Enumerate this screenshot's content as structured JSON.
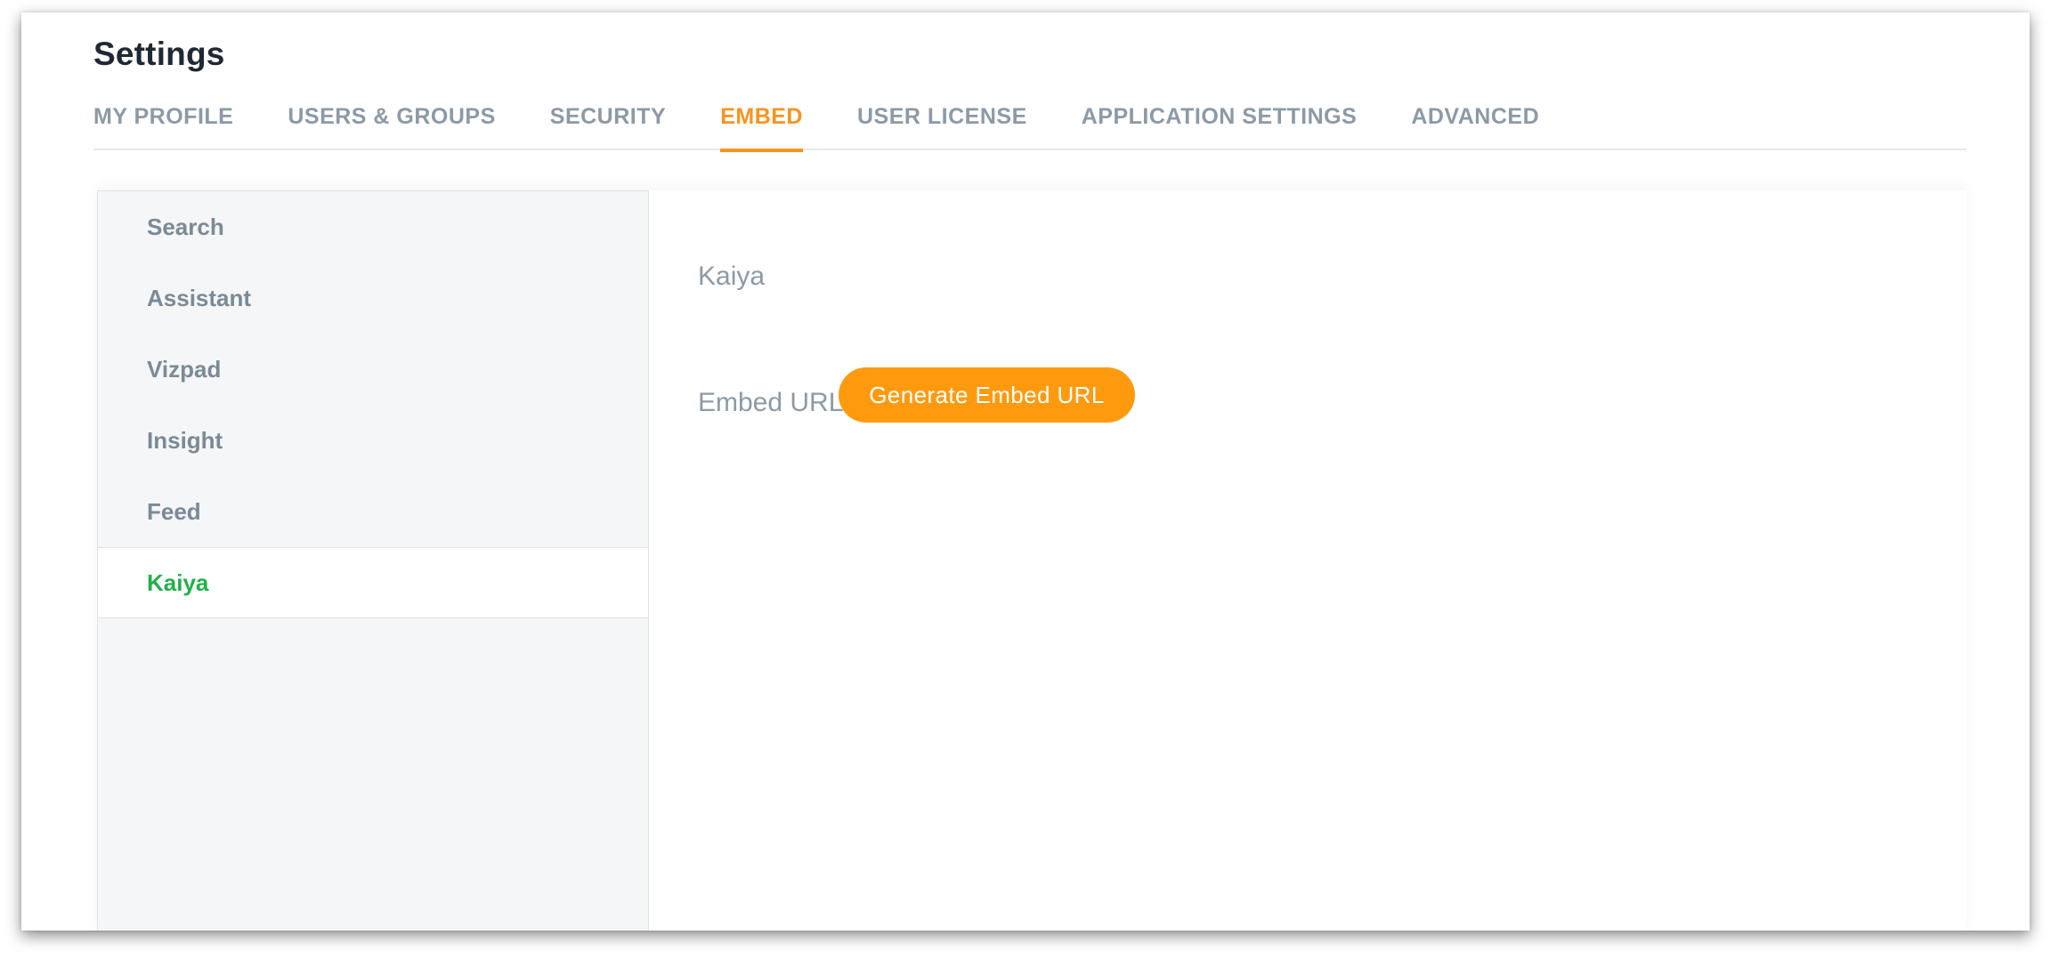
{
  "header": {
    "title": "Settings"
  },
  "tabs": [
    {
      "label": "MY PROFILE",
      "active": false
    },
    {
      "label": "USERS & GROUPS",
      "active": false
    },
    {
      "label": "SECURITY",
      "active": false
    },
    {
      "label": "EMBED",
      "active": true
    },
    {
      "label": "USER LICENSE",
      "active": false
    },
    {
      "label": "APPLICATION SETTINGS",
      "active": false
    },
    {
      "label": "ADVANCED",
      "active": false
    }
  ],
  "sidebar": {
    "items": [
      {
        "label": "Search",
        "active": false
      },
      {
        "label": "Assistant",
        "active": false
      },
      {
        "label": "Vizpad",
        "active": false
      },
      {
        "label": "Insight",
        "active": false
      },
      {
        "label": "Feed",
        "active": false
      },
      {
        "label": "Kaiya",
        "active": true
      }
    ]
  },
  "main": {
    "section_title": "Kaiya",
    "embed_url_label": "Embed URL",
    "generate_button": "Generate Embed URL"
  },
  "colors": {
    "accent_orange": "#f7941d",
    "button_orange": "#ff9a0f",
    "active_green": "#22b04a",
    "muted_text": "#8b9aa6",
    "title_text": "#1f2933"
  }
}
